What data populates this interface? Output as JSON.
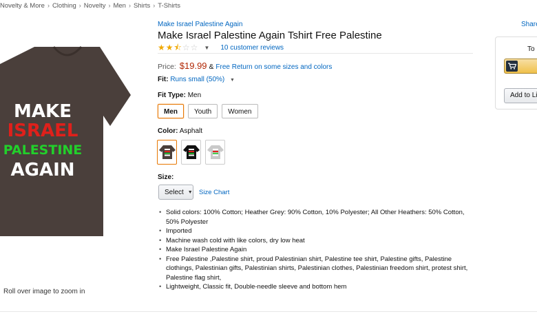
{
  "breadcrumb": [
    "Novelty & More",
    "Clothing",
    "Novelty",
    "Men",
    "Shirts",
    "T-Shirts"
  ],
  "breadcrumb_separator": "›",
  "product": {
    "brand": "Make Israel Palestine Again",
    "title": "Make Israel Palestine Again Tshirt Free Palestine",
    "image_text": [
      "MAKE",
      "ISRAEL",
      "PALESTINE",
      "AGAIN"
    ],
    "image_colors": {
      "shirt": "#4a3f3b",
      "make": "#ffffff",
      "israel": "#e0201b",
      "palestine": "#22d02b",
      "again": "#ffffff"
    },
    "zoom_hint": "Roll over image to zoom in"
  },
  "rating": {
    "stars": 2.5,
    "reviews_label": "10 customer reviews"
  },
  "price": {
    "label": "Price:",
    "value": "$19.99",
    "amp": "&",
    "free_return": "Free Return on some sizes and colors"
  },
  "fit": {
    "label": "Fit:",
    "value": "Runs small (50%)"
  },
  "fit_type": {
    "label": "Fit Type:",
    "selected": "Men",
    "options": [
      "Men",
      "Youth",
      "Women"
    ]
  },
  "color": {
    "label": "Color:",
    "selected": "Asphalt",
    "swatch_colors": [
      "#4a3f3b",
      "#111111",
      "#c9c9c9"
    ]
  },
  "size": {
    "label": "Size:",
    "select_value": "Select",
    "size_chart": "Size Chart"
  },
  "bullets": [
    "Solid colors: 100% Cotton; Heather Grey: 90% Cotton, 10% Polyester; All Other Heathers: 50% Cotton, 50% Polyester",
    "Imported",
    "Machine wash cold with like colors, dry low heat",
    "Make Israel Palestine Again",
    "Free Palestine ,Palestine shirt, proud Palestinian shirt, Palestine tee shirt, Palestine gifts, Palestine clothings, Palestinian gifts, Palestinian shirts, Palestinian clothes, Palestinian freedom shirt, protest shirt, Palestine flag shirt,",
    "Lightweight, Classic fit, Double-needle sleeve and bottom hem"
  ],
  "buybox": {
    "share": "Share",
    "to_label": "To",
    "add_to_list": "Add to Li"
  },
  "colors": {
    "link": "#0066c0",
    "price": "#b12704",
    "selected_border": "#e77600",
    "star": "#f0a800"
  }
}
